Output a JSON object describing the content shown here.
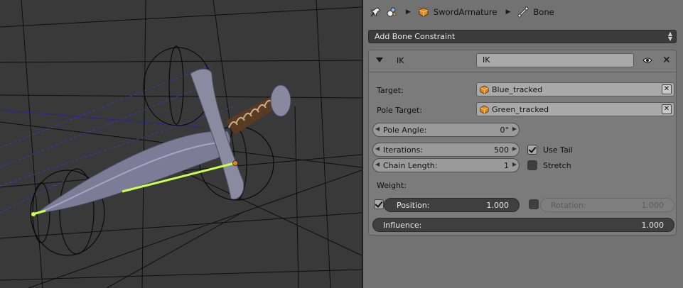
{
  "breadcrumb": {
    "armature": "SwordArmature",
    "bone": "Bone"
  },
  "add_constraint_label": "Add Bone Constraint",
  "constraint": {
    "type_label": "IK",
    "name": "IK",
    "target_label": "Target:",
    "target_value": "Blue_tracked",
    "pole_target_label": "Pole Target:",
    "pole_target_value": "Green_tracked",
    "pole_angle_label": "Pole Angle:",
    "pole_angle_value": "0°",
    "iterations_label": "Iterations:",
    "iterations_value": "500",
    "chain_length_label": "Chain Length:",
    "chain_length_value": "1",
    "use_tail_label": "Use Tail",
    "use_tail_checked": true,
    "stretch_label": "Stretch",
    "stretch_checked": false,
    "weight_label": "Weight:",
    "position_label": "Position:",
    "position_value": "1.000",
    "position_checked": true,
    "rotation_label": "Rotation:",
    "rotation_value": "1.000",
    "rotation_checked": false,
    "influence_label": "Influence:",
    "influence_value": "1.000"
  },
  "colors": {
    "viewport_bg": "#393939",
    "panel_bg": "#727272",
    "bone_highlight": "#c8ff50",
    "object_icon": "#e08a1e"
  },
  "icons": [
    "pin-icon",
    "scene-icon",
    "armature-object-icon",
    "bone-icon",
    "eye-icon",
    "close-icon",
    "cube-icon",
    "clear-icon",
    "checkbox-icon"
  ]
}
